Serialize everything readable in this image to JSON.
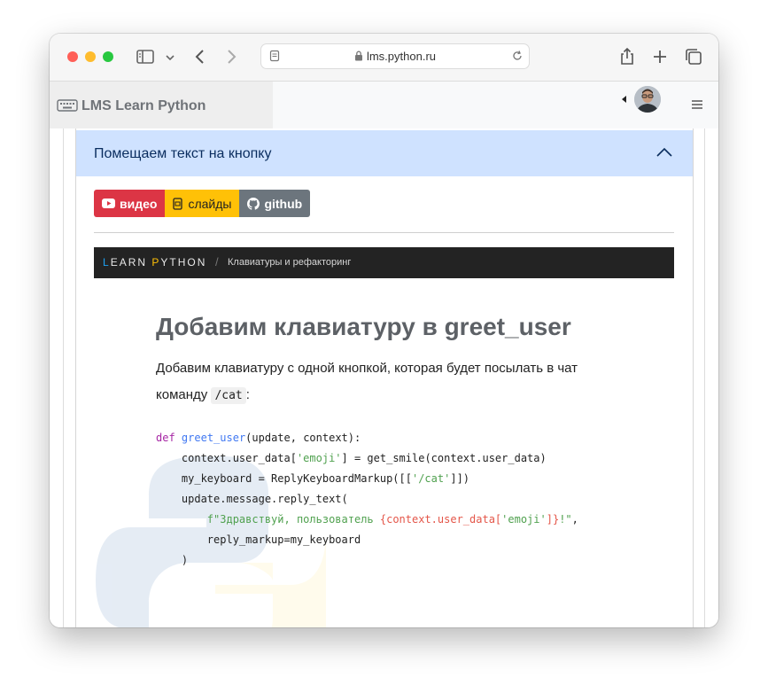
{
  "browser": {
    "url": "lms.python.ru"
  },
  "site": {
    "brand": "LMS Learn Python"
  },
  "accordion": {
    "title": "Помещаем текст на кнопку"
  },
  "badges": [
    {
      "label": "видео",
      "color": "#dc3545"
    },
    {
      "label": "слайды",
      "color": "#ffc107"
    },
    {
      "label": "github",
      "color": "#6c757d"
    }
  ],
  "lesson_bar": {
    "logo_first": "L",
    "logo_mid": "EARN ",
    "logo_p": "P",
    "logo_rest": "YTHON",
    "separator": "/",
    "breadcrumb": "Клавиатуры и рефакторинг"
  },
  "article": {
    "heading": "Добавим клавиатуру в greet_user",
    "para_before": "Добавим клавиатуру с одной кнопкой, которая будет посылать в чат команду ",
    "para_code": "/cat",
    "para_after": ":"
  },
  "code": {
    "l1_kw": "def",
    "l1_fn": "greet_user",
    "l1_rest": "(update, context):",
    "l2_a": "    context.user_data[",
    "l2_str": "'emoji'",
    "l2_b": "] = get_smile(context.user_data)",
    "l3_a": "    my_keyboard = ReplyKeyboardMarkup([[",
    "l3_str": "'/cat'",
    "l3_b": "]])",
    "l4": "    update.message.reply_text(",
    "l5_a": "        ",
    "l5_f": "f\"Здравствуй, пользователь ",
    "l5_i1": "{context.user_data[",
    "l5_s": "'emoji'",
    "l5_i2": "]}",
    "l5_end": "!\"",
    "l5_comma": ",",
    "l6": "        reply_markup=my_keyboard",
    "l7": "    )"
  },
  "colors": {
    "accordion_bg": "#cfe2ff",
    "logo_blue": "#1da1f2",
    "logo_yellow": "#ffc107"
  }
}
